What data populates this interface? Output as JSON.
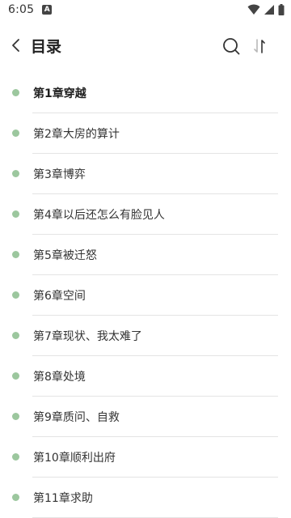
{
  "status_bar": {
    "time": "6:05",
    "notification_icon": "A"
  },
  "header": {
    "title": "目录",
    "back_icon": "chevron-left-icon",
    "search_icon": "search-icon",
    "sort_icon": "sort-icon"
  },
  "colors": {
    "dot": "#9cc79e",
    "divider": "#e4e4e4",
    "text": "#333333"
  },
  "chapters": [
    {
      "label": "第1章穿越",
      "current": true
    },
    {
      "label": "第2章大房的算计",
      "current": false
    },
    {
      "label": "第3章博弈",
      "current": false
    },
    {
      "label": "第4章以后还怎么有脸见人",
      "current": false
    },
    {
      "label": "第5章被迁怒",
      "current": false
    },
    {
      "label": "第6章空间",
      "current": false
    },
    {
      "label": "第7章现状、我太难了",
      "current": false
    },
    {
      "label": "第8章处境",
      "current": false
    },
    {
      "label": "第9章质问、自救",
      "current": false
    },
    {
      "label": "第10章顺利出府",
      "current": false
    },
    {
      "label": "第11章求助",
      "current": false
    }
  ]
}
